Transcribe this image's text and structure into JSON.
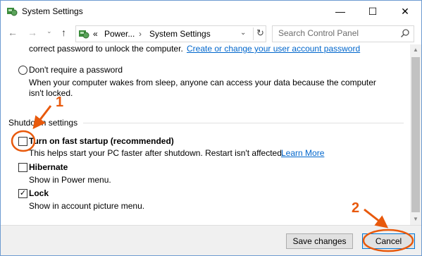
{
  "window": {
    "title": "System Settings"
  },
  "title_controls": {
    "minimize": "—",
    "maximize": "☐",
    "close": "✕"
  },
  "navigation": {
    "back": "←",
    "forward": "→",
    "recent": "⌄",
    "up": "↑",
    "address_prefix": "«",
    "breadcrumb": [
      "Power...",
      "System Settings"
    ],
    "separator": "›",
    "dropdown": "⌄",
    "refresh": "↻",
    "search_placeholder": "Search Control Panel"
  },
  "content": {
    "password_text": "correct password to unlock the computer.",
    "password_link": "Create or change your user account password",
    "no_password_label": "Don't require a password",
    "no_password_desc_1": "When your computer wakes from sleep, anyone can access your data because the computer",
    "no_password_desc_2": "isn't locked.",
    "shutdown_heading": "Shutdown settings",
    "options": [
      {
        "label": "Turn on fast startup (recommended)",
        "desc": "This helps start your PC faster after shutdown. Restart isn't affected.",
        "link": "Learn More",
        "checked": false
      },
      {
        "label": "Hibernate",
        "desc": "Show in Power menu.",
        "checked": false
      },
      {
        "label": "Lock",
        "desc": "Show in account picture menu.",
        "checked": true
      }
    ],
    "check_mark": "✓"
  },
  "scrollbar": {
    "up": "▲",
    "down": "▼"
  },
  "footer": {
    "save_label": "Save changes",
    "cancel_label": "Cancel"
  },
  "annotations": {
    "step1": "1",
    "step2": "2",
    "color": "#e8590c"
  }
}
